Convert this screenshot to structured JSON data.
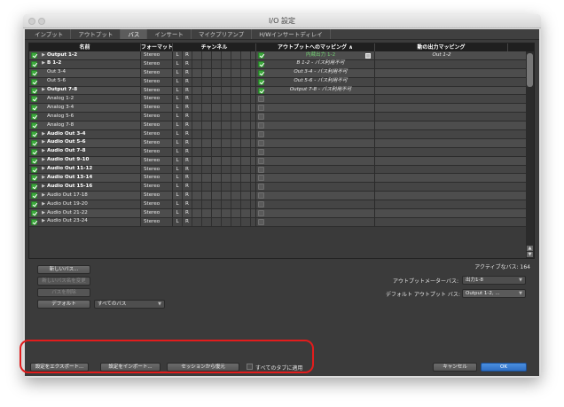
{
  "window": {
    "title": "I/O 設定"
  },
  "tabs": [
    {
      "label": "インプット",
      "active": false
    },
    {
      "label": "アウトプット",
      "active": false
    },
    {
      "label": "バス",
      "active": true
    },
    {
      "label": "インサート",
      "active": false
    },
    {
      "label": "マイクプリアンプ",
      "active": false
    },
    {
      "label": "H/Wインサートディレイ",
      "active": false
    }
  ],
  "table": {
    "headers": {
      "name": "名前",
      "format": "フォーマット",
      "channels": "チャンネル",
      "mapping": "アウトプットへのマッピング ∧",
      "sub_output": "動の出力マッピング"
    },
    "rows": [
      {
        "name": "Output 1-2",
        "expand": true,
        "bold": true,
        "checked": true,
        "format": "Stereo",
        "map_checked": true,
        "map": "内蔵出力 1-2",
        "map_green": true,
        "edit_icon": true,
        "out": "Out 1-2"
      },
      {
        "name": "B 1-2",
        "expand": true,
        "bold": true,
        "checked": true,
        "format": "Stereo",
        "map_checked": true,
        "map": "B 1-2 - バス利用不可",
        "out": ""
      },
      {
        "name": "Out 3-4",
        "expand": false,
        "bold": false,
        "checked": true,
        "format": "Stereo",
        "map_checked": true,
        "map": "Out 3-4 - バス利用不可",
        "out": ""
      },
      {
        "name": "Out 5-6",
        "expand": false,
        "bold": false,
        "checked": true,
        "format": "Stereo",
        "map_checked": true,
        "map": "Out 5-6 - バス利用不可",
        "out": ""
      },
      {
        "name": "Output 7-8",
        "expand": true,
        "bold": true,
        "checked": true,
        "format": "Stereo",
        "map_checked": true,
        "map": "Output 7-8 - バス利用不可",
        "out": ""
      },
      {
        "name": "Analog 1-2",
        "expand": false,
        "bold": false,
        "checked": true,
        "format": "Stereo",
        "map_checked": false,
        "map": "",
        "out": ""
      },
      {
        "name": "Analog 3-4",
        "expand": false,
        "bold": false,
        "checked": true,
        "format": "Stereo",
        "map_checked": false,
        "map": "",
        "out": ""
      },
      {
        "name": "Analog 5-6",
        "expand": false,
        "bold": false,
        "checked": true,
        "format": "Stereo",
        "map_checked": false,
        "map": "",
        "out": ""
      },
      {
        "name": "Analog 7-8",
        "expand": false,
        "bold": false,
        "checked": true,
        "format": "Stereo",
        "map_checked": false,
        "map": "",
        "out": ""
      },
      {
        "name": "Audio Out 3-4",
        "expand": true,
        "bold": true,
        "checked": true,
        "format": "Stereo",
        "map_checked": false,
        "map": "",
        "out": ""
      },
      {
        "name": "Audio Out 5-6",
        "expand": true,
        "bold": true,
        "checked": true,
        "format": "Stereo",
        "map_checked": false,
        "map": "",
        "out": ""
      },
      {
        "name": "Audio Out 7-8",
        "expand": true,
        "bold": true,
        "checked": true,
        "format": "Stereo",
        "map_checked": false,
        "map": "",
        "out": ""
      },
      {
        "name": "Audio Out 9-10",
        "expand": true,
        "bold": true,
        "checked": true,
        "format": "Stereo",
        "map_checked": false,
        "map": "",
        "out": ""
      },
      {
        "name": "Audio Out 11-12",
        "expand": true,
        "bold": true,
        "checked": true,
        "format": "Stereo",
        "map_checked": false,
        "map": "",
        "out": ""
      },
      {
        "name": "Audio Out 13-14",
        "expand": true,
        "bold": true,
        "checked": true,
        "format": "Stereo",
        "map_checked": false,
        "map": "",
        "out": ""
      },
      {
        "name": "Audio Out 15-16",
        "expand": true,
        "bold": true,
        "checked": true,
        "format": "Stereo",
        "map_checked": false,
        "map": "",
        "out": ""
      },
      {
        "name": "Audio Out 17-18",
        "expand": true,
        "bold": false,
        "checked": true,
        "format": "Stereo",
        "map_checked": false,
        "map": "",
        "out": ""
      },
      {
        "name": "Audio Out 19-20",
        "expand": true,
        "bold": false,
        "checked": true,
        "format": "Stereo",
        "map_checked": false,
        "map": "",
        "out": ""
      },
      {
        "name": "Audio Out 21-22",
        "expand": true,
        "bold": false,
        "checked": true,
        "format": "Stereo",
        "map_checked": false,
        "map": "",
        "out": ""
      },
      {
        "name": "Audio Out 23-24",
        "expand": true,
        "bold": false,
        "checked": true,
        "format": "Stereo",
        "map_checked": false,
        "map": "",
        "out": ""
      }
    ],
    "channel_labels": [
      "L",
      "R"
    ]
  },
  "left_buttons": {
    "new_bus": "新しいバス...",
    "btn2": "新しいバス名を変更",
    "btn3": "バスを削除",
    "default": "デフォルト",
    "default_select": "すべてのバス"
  },
  "right_panel": {
    "active_bus": "アクティブなバス: 164",
    "output_meter_label": "アウトプットメーターバス:",
    "output_meter_value": "出力1-8",
    "default_output_label": "デフォルト アウトプット バス:",
    "default_output_value": "Output 1-2, ..."
  },
  "bottom": {
    "export": "設定をエクスポート...",
    "import": "設定をインポート...",
    "restore": "セッションから復元",
    "apply_all": "すべてのタブに適用",
    "cancel": "キャンセル",
    "ok": "OK"
  }
}
